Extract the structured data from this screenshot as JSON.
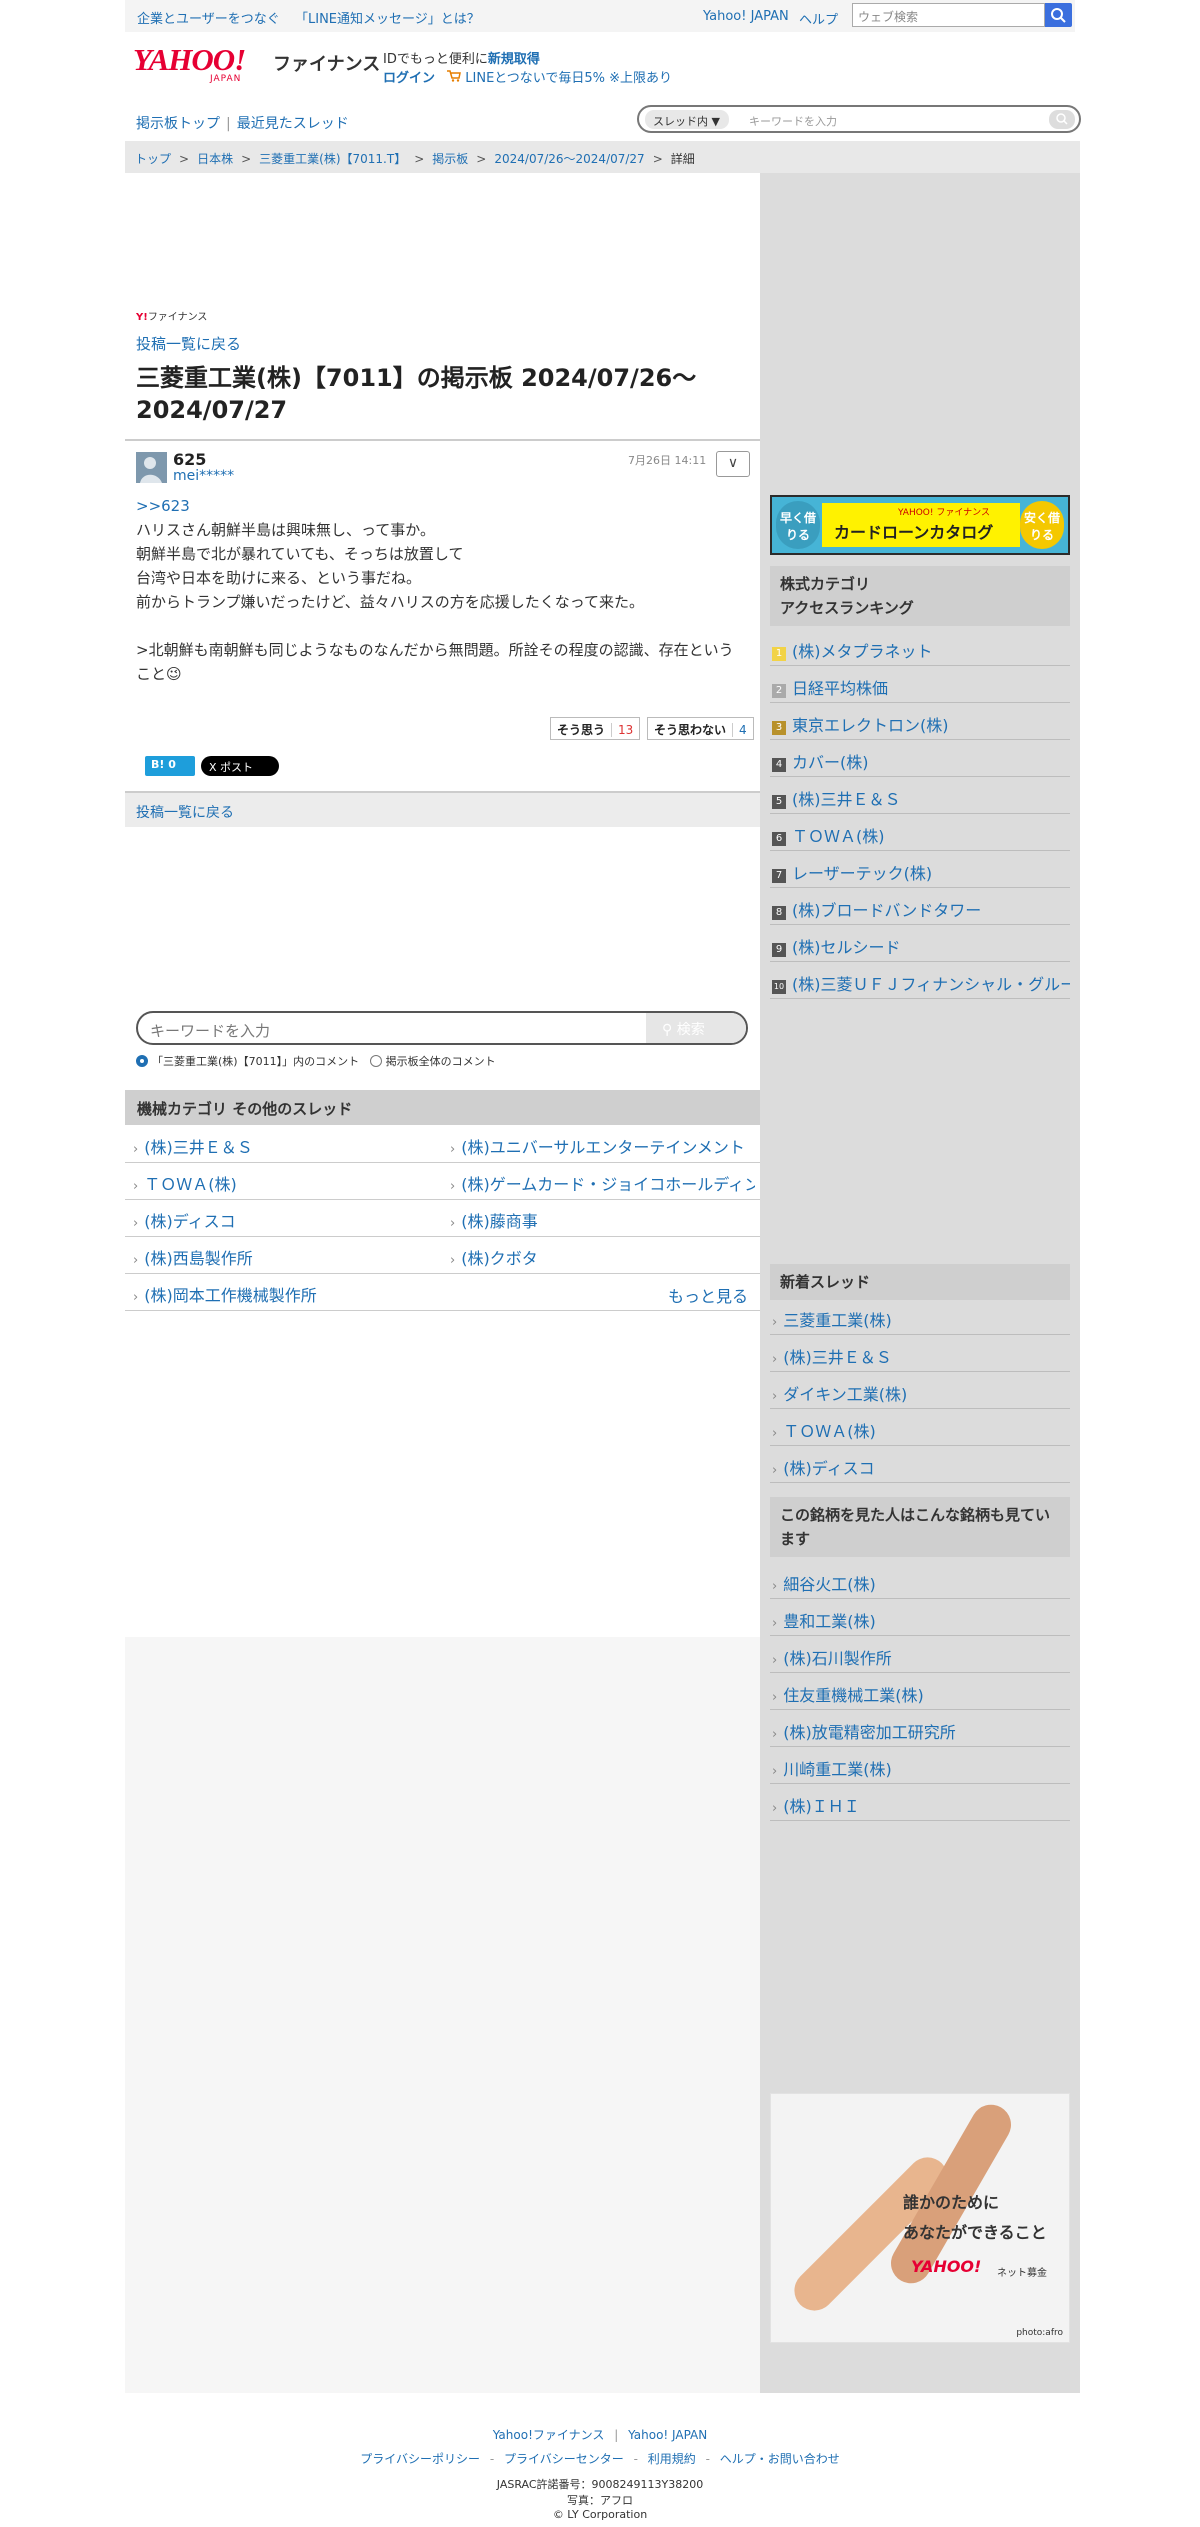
{
  "topbar": {
    "link1": "企業とユーザーをつなぐ",
    "link2": "「LINE通知メッセージ」とは？",
    "yahoo_japan": "Yahoo! JAPAN",
    "help": "ヘルプ",
    "search_placeholder": "ウェブ検索"
  },
  "header": {
    "logo_text": "YAHOO!",
    "logo_sub": "JAPAN",
    "service": "ファイナンス",
    "promo_prefix": "IDでもっと便利に",
    "promo_link": "新規取得",
    "login": "ログイン",
    "line_promo": "LINEとつないで毎日5% ※上限あり"
  },
  "subnav": {
    "board_top": "掲示板トップ",
    "separator": "|",
    "recent": "最近見たスレッド",
    "scope": "スレッド内",
    "keyword_placeholder": "キーワードを入力"
  },
  "breadcrumb": [
    "トップ",
    "日本株",
    "三菱重工業(株)【7011.T】",
    "掲示板",
    "2024/07/26〜2024/07/27",
    "詳細"
  ],
  "breadcrumb_sep": ">",
  "main": {
    "mini_logo_y": "Y!",
    "mini_logo_text": "ファイナンス",
    "back_link": "投稿一覧に戻る",
    "title": "三菱重工業(株)【7011】の掲示板 2024/07/26〜2024/07/27",
    "post": {
      "number": "625",
      "user": "mei*****",
      "date": "7月26日 14:11",
      "menu_icon": "∨",
      "reply_to": ">>623",
      "lines": [
        "ハリスさん朝鮮半島は興味無し、って事か。",
        "朝鮮半島で北が暴れていても、そっちは放置して",
        "台湾や日本を助けに来る、という事だね。",
        "前からトランプ嫌いだったけど、益々ハリスの方を応援したくなって来た。",
        "",
        ">北朝鮮も南朝鮮も同じようなものなんだから無問題。所詮その程度の認識、存在ということ😉"
      ],
      "agree_label": "そう思う",
      "agree_count": "13",
      "disagree_label": "そう思わない",
      "disagree_count": "4"
    },
    "share": {
      "hatena": "B! 0",
      "x_post": "X ポスト"
    },
    "back_link2": "投稿一覧に戻る",
    "search": {
      "placeholder": "キーワードを入力",
      "button": "検索",
      "radio1": "「三菱重工業(株)【7011】」内のコメント",
      "radio2": "掲示板全体のコメント"
    },
    "category": {
      "header": "機械カテゴリ  その他のスレッド",
      "items": [
        "(株)三井Ｅ＆Ｓ",
        "(株)ユニバーサルエンターテインメント",
        "ＴＯＷＡ(株)",
        "(株)ゲームカード・ジョイコホールディングス",
        "(株)ディスコ",
        "(株)藤商事",
        "(株)西島製作所",
        "(株)クボタ",
        "(株)岡本工作機械製作所"
      ],
      "more": "もっと見る"
    }
  },
  "sidebar": {
    "banner": {
      "left": "早く借りる",
      "right": "安く借りる",
      "brand": "YAHOO! ファイナンス",
      "title": "カードローンカタログ"
    },
    "ranking_header_line1": "株式カテゴリ",
    "ranking_header_line2": "アクセスランキング",
    "ranking": [
      {
        "rank": "1",
        "name": "(株)メタプラネット"
      },
      {
        "rank": "2",
        "name": "日経平均株価"
      },
      {
        "rank": "3",
        "name": "東京エレクトロン(株)"
      },
      {
        "rank": "4",
        "name": "カバー(株)"
      },
      {
        "rank": "5",
        "name": "(株)三井Ｅ＆Ｓ"
      },
      {
        "rank": "6",
        "name": "ＴＯＷＡ(株)"
      },
      {
        "rank": "7",
        "name": "レーザーテック(株)"
      },
      {
        "rank": "8",
        "name": "(株)ブロードバンドタワー"
      },
      {
        "rank": "9",
        "name": "(株)セルシード"
      },
      {
        "rank": "10",
        "name": "(株)三菱ＵＦＪフィナンシャル・グループ"
      }
    ],
    "new_threads_header": "新着スレッド",
    "new_threads": [
      "三菱重工業(株)",
      "(株)三井Ｅ＆Ｓ",
      "ダイキン工業(株)",
      "ＴＯＷＡ(株)",
      "(株)ディスコ"
    ],
    "also_viewed_header": "この銘柄を見た人はこんな銘柄も見ています",
    "also_viewed": [
      "細谷火工(株)",
      "豊和工業(株)",
      "(株)石川製作所",
      "住友重機械工業(株)",
      "(株)放電精密加工研究所",
      "川崎重工業(株)",
      "(株)ＩＨＩ"
    ],
    "ad2": {
      "line1": "誰かのために",
      "line2": "あなたができること",
      "logo": "YAHOO!",
      "logo_sub": "ネット募金",
      "credit": "photo:afro"
    }
  },
  "footer": {
    "links1": [
      "Yahoo!ファイナンス",
      "Yahoo! JAPAN"
    ],
    "links2": [
      "プライバシーポリシー",
      "プライバシーセンター",
      "利用規約",
      "ヘルプ・お問い合わせ"
    ],
    "jasrac": "JASRAC許諾番号：9008249113Y38200",
    "photo": "写真：アフロ",
    "copyright": "© LY Corporation"
  },
  "colors": {
    "link": "#1f6fb3",
    "brand_red": "#e60033",
    "sidebar_bg": "#dcdcdc"
  }
}
